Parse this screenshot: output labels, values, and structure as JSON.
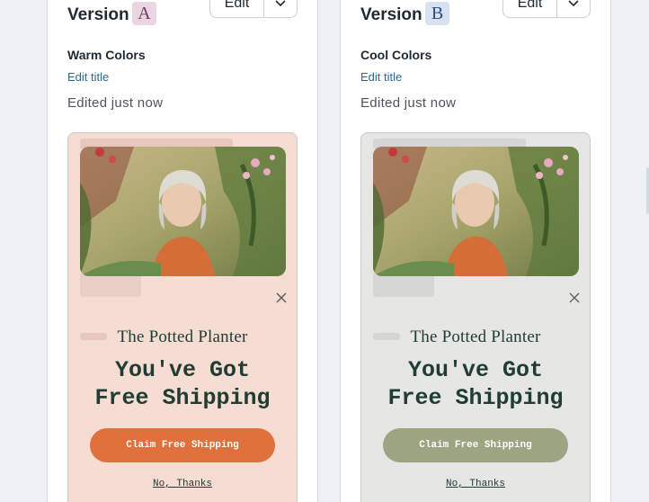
{
  "versions": [
    {
      "version_label": "Version",
      "badge": "A",
      "edit_label": "Edit",
      "title": "Warm Colors",
      "edit_title_label": "Edit title",
      "edited": "Edited just now",
      "preview": {
        "brand": "The Potted Planter",
        "headline": [
          "You've Got",
          "Free Shipping"
        ],
        "cta": "Claim Free Shipping",
        "decline": "No, Thanks",
        "background_color": "#f5ddd3",
        "cta_color": "#e0703c"
      }
    },
    {
      "version_label": "Version",
      "badge": "B",
      "edit_label": "Edit",
      "title": "Cool Colors",
      "edit_title_label": "Edit title",
      "edited": "Edited just now",
      "preview": {
        "brand": "The Potted Planter",
        "headline": [
          "You've Got",
          "Free Shipping"
        ],
        "cta": "Claim Free Shipping",
        "decline": "No, Thanks",
        "background_color": "#e6e6e4",
        "cta_color": "#9da482"
      }
    }
  ],
  "icons": {
    "dropdown": "chevron-down-icon",
    "close": "close-icon"
  },
  "colors": {
    "link": "#2b6c8f",
    "text_dark": "#213c33"
  }
}
